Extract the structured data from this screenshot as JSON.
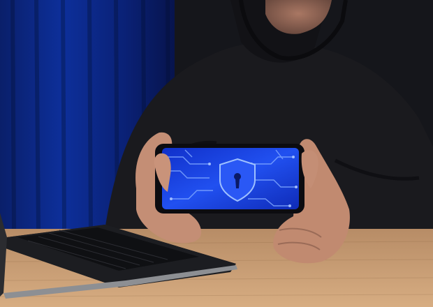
{
  "scene": {
    "subject": "hooded-person-holding-smartphone",
    "phone_screen_icon": "shield-keyhole-icon",
    "colors": {
      "curtain": "#0d2a8a",
      "hoodie": "#17171a",
      "skin": "#c08a72",
      "table": "#c59a70",
      "laptop": "#1f2024",
      "screen_glow": "#1c46e0",
      "circuit": "#6f9bff"
    }
  }
}
